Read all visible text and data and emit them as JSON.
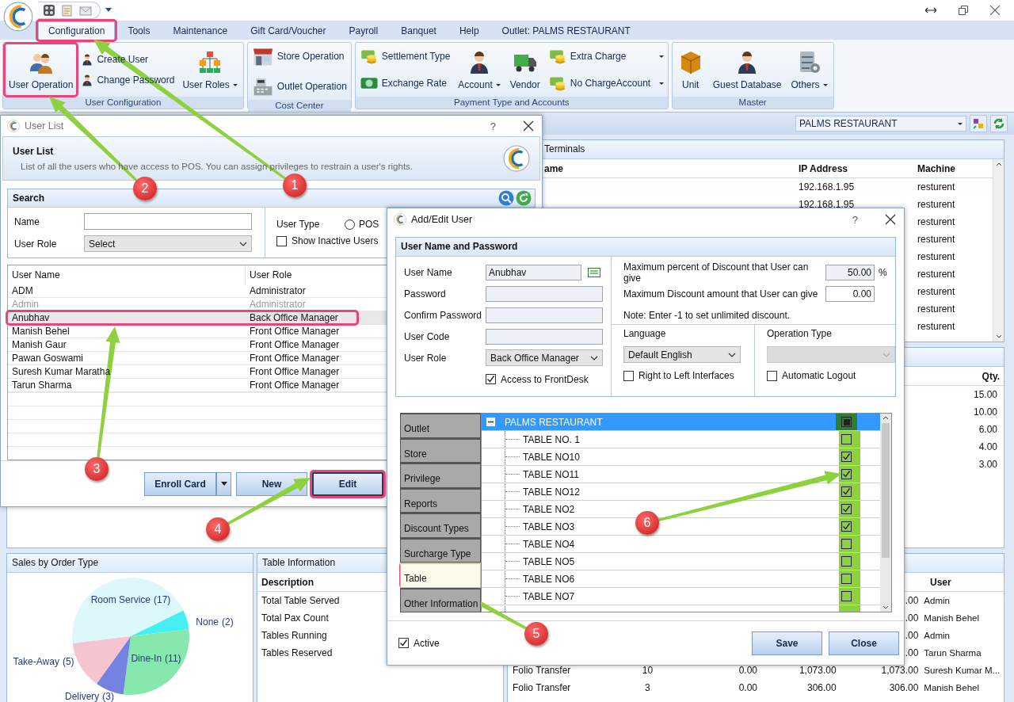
{
  "menu_tabs": [
    {
      "label": "Configuration",
      "selected": true
    },
    {
      "label": "Tools",
      "selected": false
    },
    {
      "label": "Maintenance",
      "selected": false
    },
    {
      "label": "Gift Card/Voucher",
      "selected": false
    },
    {
      "label": "Payroll",
      "selected": false
    },
    {
      "label": "Banquet",
      "selected": false
    },
    {
      "label": "Help",
      "selected": false
    },
    {
      "label": "Outlet: PALMS RESTAURANT",
      "selected": false
    }
  ],
  "ribbon": [
    {
      "label": "User Configuration",
      "items": [
        {
          "label": "User Operation",
          "kind": "large",
          "dropdown": false
        },
        {
          "label": "Create User",
          "kind": "small",
          "dropdown": false
        },
        {
          "label": "Change Password",
          "kind": "small",
          "dropdown": false
        },
        {
          "label": "User Roles",
          "kind": "large",
          "dropdown": true
        }
      ]
    },
    {
      "label": "Cost Center",
      "items": [
        {
          "label": "Store Operation",
          "kind": "small",
          "dropdown": false
        },
        {
          "label": "Outlet Operation",
          "kind": "small",
          "dropdown": false
        }
      ]
    },
    {
      "label": "Payment Type and Accounts",
      "items": [
        {
          "label": "Settlement Type",
          "kind": "small",
          "dropdown": false
        },
        {
          "label": "Exchange Rate",
          "kind": "small",
          "dropdown": false
        },
        {
          "label": "Account",
          "kind": "large",
          "dropdown": true
        },
        {
          "label": "Vendor",
          "kind": "large",
          "dropdown": false
        },
        {
          "label": "Extra Charge",
          "kind": "small",
          "dropdown": true
        },
        {
          "label": "No ChargeAccount",
          "kind": "small",
          "dropdown": true
        }
      ]
    },
    {
      "label": "Master",
      "items": [
        {
          "label": "Unit",
          "kind": "large",
          "dropdown": false
        },
        {
          "label": "Guest Database",
          "kind": "large",
          "dropdown": false
        },
        {
          "label": "Others",
          "kind": "large",
          "dropdown": true
        }
      ]
    }
  ],
  "outlet_select": {
    "value": "PALMS RESTAURANT"
  },
  "terminals": {
    "title": "Terminals",
    "columns": [
      "ame",
      "IP Address",
      "Machine"
    ],
    "rows": [
      {
        "ip": "192.168.1.95",
        "machine": "resturent"
      },
      {
        "ip": "192.168.1.95",
        "machine": "resturent"
      },
      {
        "machine": "resturent"
      },
      {
        "machine": "resturent"
      },
      {
        "machine": "resturent"
      },
      {
        "machine": "resturent"
      },
      {
        "machine": "resturent"
      },
      {
        "machine": "resturent"
      },
      {
        "machine": "resturent"
      }
    ]
  },
  "quantity_panel": {
    "column": "Qty.",
    "rows": [
      "15.00",
      "10.00",
      "6.00",
      "4.00",
      "3.00"
    ]
  },
  "transactions_panel": {
    "user_column": "User",
    "rows": [
      {
        "column_5": ".00",
        "user": "Admin"
      },
      {
        "column_5": ".00",
        "user": "Manish Behel"
      },
      {
        "column_5": ".00",
        "user": "Admin"
      },
      {
        "column_5": ".00",
        "user": "Tarun Sharma"
      },
      {
        "column_1": "Folio Transfer",
        "column_2": "10",
        "column_3": "0.00",
        "column_4": "1,073.00",
        "column_5": "1,073.00",
        "user": "Suresh Kumar M..."
      },
      {
        "column_1": "Folio Transfer",
        "column_2": "3",
        "column_3": "0.00",
        "column_4": "306.00",
        "column_5": "306.00",
        "user": "Manish Behel"
      }
    ]
  },
  "sales_panel": {
    "title": "Sales by Order Type",
    "chart_data": {
      "type": "pie",
      "categories": [
        "Room Service",
        "None",
        "Dine-In",
        "Delivery",
        "Take-Away"
      ],
      "values": [
        17,
        2,
        11,
        3,
        5
      ],
      "value_labels": [
        "(17)",
        "(2)",
        "(11)",
        "(3)",
        "(5)"
      ]
    }
  },
  "table_info": {
    "title": "Table Information",
    "column": "Description",
    "rows": [
      "Total Table Served",
      "Total Pax Count",
      "Tables Running",
      "Tables Reserved"
    ]
  },
  "user_list": {
    "title": "User List",
    "help": "?",
    "heading": "User List",
    "description": "List of all the users who have access to POS. You can assign privileges to restrain a user's rights.",
    "search": {
      "title": "Search",
      "name_label": "Name",
      "role_label": "User Role",
      "role_value": "Select",
      "type_label": "User Type",
      "pos": {
        "label": "POS",
        "selected": false
      },
      "inactive": {
        "label": "Show Inactive Users",
        "checked": false
      }
    },
    "columns": [
      "User Name",
      "User Role"
    ],
    "users": [
      {
        "name": "ADM",
        "role": "Administrator",
        "inactive": false,
        "selected": false
      },
      {
        "name": "Admin",
        "role": "Administrator",
        "inactive": true,
        "selected": false
      },
      {
        "name": "Anubhav",
        "role": "Back Office Manager",
        "inactive": false,
        "selected": true
      },
      {
        "name": "Manish Behel",
        "role": "Front Office Manager",
        "inactive": false,
        "selected": false
      },
      {
        "name": "Manish Gaur",
        "role": "Front Office Manager",
        "inactive": false,
        "selected": false
      },
      {
        "name": "Pawan Goswami",
        "role": "Front Office Manager",
        "inactive": false,
        "selected": false
      },
      {
        "name": "Suresh Kumar Maratha",
        "role": "Front Office Manager",
        "inactive": false,
        "selected": false
      },
      {
        "name": "Tarun Sharma",
        "role": "Front Office Manager",
        "inactive": false,
        "selected": false
      }
    ],
    "buttons": [
      {
        "label": "Enroll Card",
        "kind": "split"
      },
      {
        "label": "New",
        "kind": "plain"
      },
      {
        "label": "Edit",
        "kind": "default"
      }
    ]
  },
  "edit_dialog": {
    "title": "Add/Edit User",
    "help": "?",
    "section": "User Name and Password",
    "fields": [
      {
        "label": "User Name",
        "value": "Anubhav",
        "kind": "keyboard"
      },
      {
        "label": "Password",
        "kind": "text"
      },
      {
        "label": "Confirm Password",
        "kind": "text"
      },
      {
        "label": "User Code",
        "kind": "text"
      },
      {
        "label": "User Role",
        "value": "Back Office Manager",
        "kind": "select"
      }
    ],
    "frontdesk": {
      "label": "Access to FrontDesk",
      "checked": true
    },
    "discounts": [
      {
        "label": "Maximum percent of Discount that User can give",
        "value": "50.00",
        "unit": "%"
      },
      {
        "label": "Maximum Discount amount that User can give",
        "value": "0.00"
      }
    ],
    "note": "Note: Enter -1 to set unlimited discount.",
    "language": {
      "label": "Language",
      "value": "Default English"
    },
    "rtl": {
      "label": "Right to Left Interfaces",
      "checked": false
    },
    "operation_type": {
      "label": "Operation Type",
      "disabled": true
    },
    "auto_logout": {
      "label": "Automatic Logout",
      "checked": false
    },
    "tabs": [
      {
        "label": "Outlet",
        "selected": false
      },
      {
        "label": "Store",
        "selected": false
      },
      {
        "label": "Privilege",
        "selected": false
      },
      {
        "label": "Reports",
        "selected": false
      },
      {
        "label": "Discount Types",
        "selected": false
      },
      {
        "label": "Surcharge Type",
        "selected": false
      },
      {
        "label": "Table",
        "selected": true
      },
      {
        "label": "Other Information",
        "selected": false
      }
    ],
    "tree": {
      "name": "PALMS RESTAURANT",
      "expanded": true,
      "selected": true,
      "partial": true,
      "children": [
        {
          "name": "TABLE NO. 1",
          "checked": false
        },
        {
          "name": "TABLE NO10",
          "checked": true
        },
        {
          "name": "TABLE NO11",
          "checked": true
        },
        {
          "name": "TABLE NO12",
          "checked": true
        },
        {
          "name": "TABLE NO2",
          "checked": true
        },
        {
          "name": "TABLE NO3",
          "checked": true
        },
        {
          "name": "TABLE NO4",
          "checked": false
        },
        {
          "name": "TABLE NO5",
          "checked": false
        },
        {
          "name": "TABLE NO6",
          "checked": false
        },
        {
          "name": "TABLE NO7",
          "checked": false
        }
      ]
    },
    "active": {
      "label": "Active",
      "checked": true
    },
    "buttons": [
      "Save",
      "Close"
    ]
  },
  "callouts": [
    "1",
    "2",
    "3",
    "4",
    "5",
    "6"
  ]
}
